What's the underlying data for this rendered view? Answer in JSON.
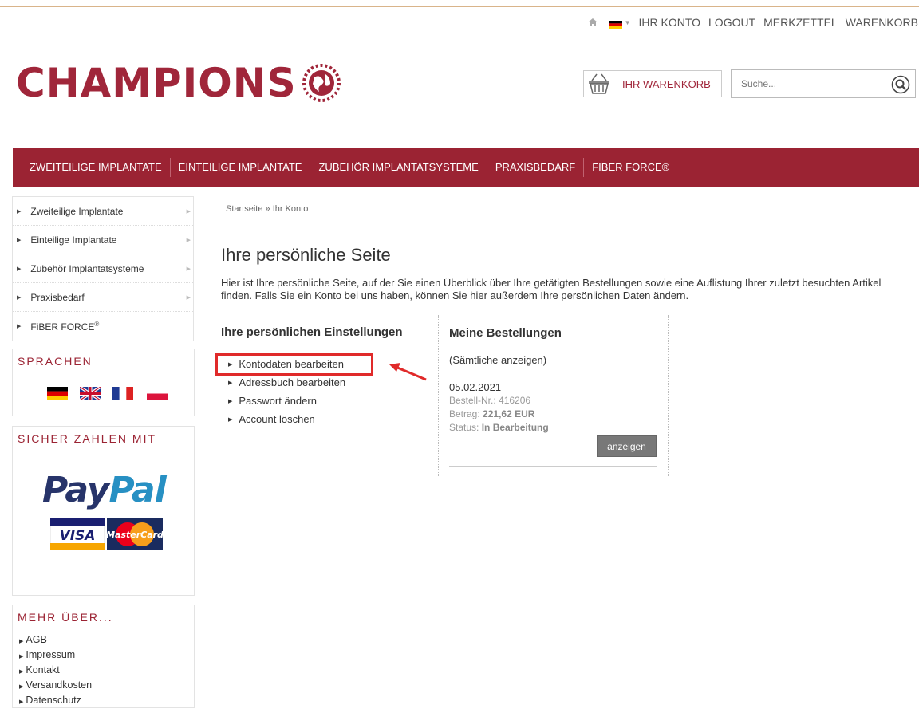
{
  "topnav": {
    "links": [
      "IHR KONTO",
      "LOGOUT",
      "MERKZETTEL",
      "WARENKORB"
    ]
  },
  "logo": {
    "text": "CHAMPIONS"
  },
  "cart": {
    "label": "IHR WARENKORB"
  },
  "search": {
    "placeholder": "Suche..."
  },
  "mainnav": [
    "ZWEITEILIGE IMPLANTATE",
    "EINTEILIGE IMPLANTATE",
    "ZUBEHÖR IMPLANTATSYSTEME",
    "PRAXISBEDARF",
    "FIBER FORCE®"
  ],
  "sidebar": {
    "categories": [
      "Zweiteilige Implantate",
      "Einteilige Implantate",
      "Zubehör Implantatsysteme",
      "Praxisbedarf"
    ],
    "fiber": {
      "text": "FiBER FORCE",
      "sup": "®"
    },
    "languages_title": "SPRACHEN",
    "payment_title": "SICHER ZAHLEN MIT",
    "paypal": {
      "pay": "Pay",
      "pal": "Pal"
    },
    "cards": {
      "visa": "VISA",
      "mastercard": "MasterCard"
    },
    "more_title": "MEHR ÜBER...",
    "more_links": [
      "AGB",
      "Impressum",
      "Kontakt",
      "Versandkosten",
      "Datenschutz"
    ]
  },
  "breadcrumb": {
    "home": "Startseite",
    "sep": " » ",
    "current": "Ihr Konto"
  },
  "page": {
    "title": "Ihre persönliche Seite",
    "intro": "Hier ist Ihre persönliche Seite, auf der Sie einen Überblick über Ihre getätigten Bestellungen sowie eine Auflistung Ihrer zuletzt besuchten Artikel finden. Falls Sie ein Konto bei uns haben, können Sie hier außerdem Ihre persönlichen Daten ändern."
  },
  "settings": {
    "title": "Ihre persönlichen Einstellungen",
    "items": [
      "Kontodaten bearbeiten",
      "Adressbuch bearbeiten",
      "Passwort ändern",
      "Account löschen"
    ]
  },
  "orders": {
    "title": "Meine Bestellungen",
    "show_all": "(Sämtliche anzeigen)",
    "date": "05.02.2021",
    "number_label": "Bestell-Nr.:",
    "number": "416206",
    "amount_label": "Betrag:",
    "amount": "221,62 EUR",
    "status_label": "Status:",
    "status": "In Bearbeitung",
    "button": "anzeigen"
  },
  "colors": {
    "brand": "#9b2333",
    "highlight": "#e02a2a"
  }
}
